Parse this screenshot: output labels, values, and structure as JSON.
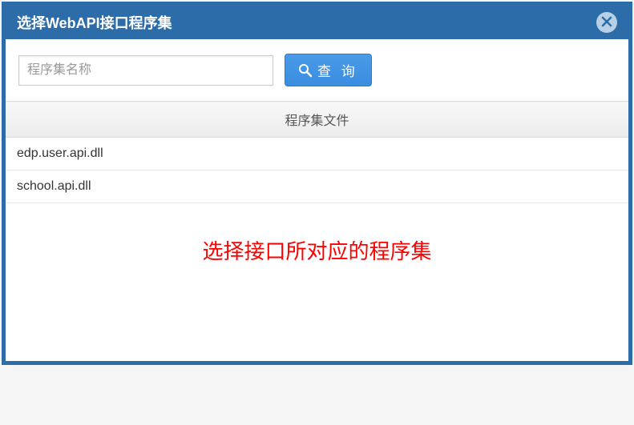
{
  "dialog": {
    "title": "选择WebAPI接口程序集"
  },
  "search": {
    "placeholder": "程序集名称",
    "value": "",
    "button_label": "查 询"
  },
  "table": {
    "header": "程序集文件",
    "rows": [
      {
        "file": "edp.user.api.dll"
      },
      {
        "file": "school.api.dll"
      }
    ]
  },
  "annotation": {
    "text": "选择接口所对应的程序集"
  }
}
